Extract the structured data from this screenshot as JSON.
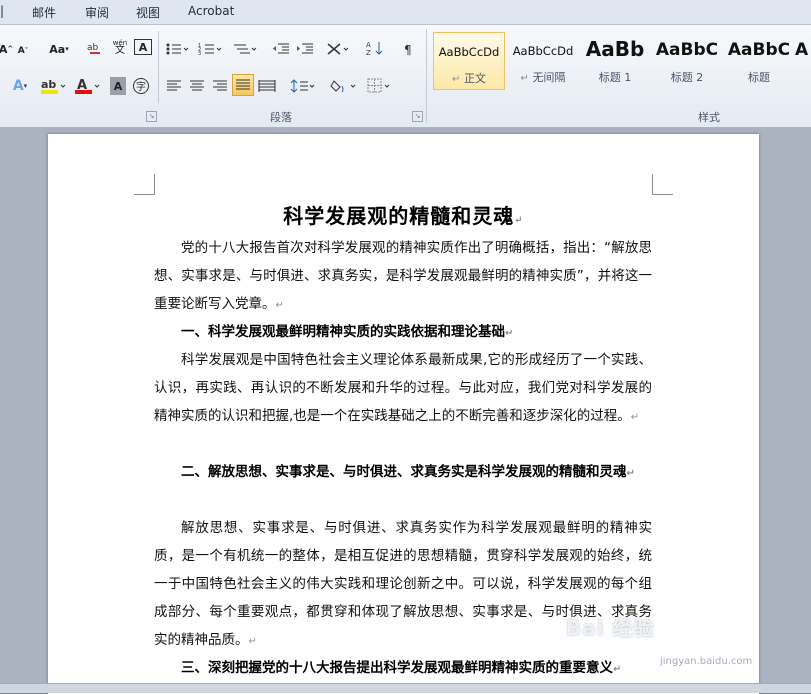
{
  "tabs": [
    "邮件",
    "审阅",
    "视图",
    "Acrobat"
  ],
  "ribbon": {
    "font_row1": {
      "grow": "A",
      "shrink": "A",
      "case": "Aa",
      "pinyin": "wén"
    },
    "para_label": "段落",
    "styles_label": "样式",
    "styles": [
      {
        "sample": "AaBbCcDd",
        "name": "正文"
      },
      {
        "sample": "AaBbCcDd",
        "name": "无间隔"
      },
      {
        "sample": "AaBb",
        "name": "标题 1"
      },
      {
        "sample": "AaBbC",
        "name": "标题 2"
      },
      {
        "sample": "AaBbC",
        "name": "标题"
      },
      {
        "sample": "A",
        "name": ""
      }
    ]
  },
  "document": {
    "title": "科学发展观的精髓和灵魂",
    "p1": "党的十八大报告首次对科学发展观的精神实质作出了明确概括，指出：“解放思想、实事求是、与时俱进、求真务实，是科学发展观最鲜明的精神实质”，并将这一重要论断写入党章。",
    "h1": "一、科学发展观最鲜明精神实质的实践依据和理论基础",
    "p2": "科学发展观是中国特色社会主义理论体系最新成果,它的形成经历了一个实践、认识，再实践、再认识的不断发展和升华的过程。与此对应，我们党对科学发展的精神实质的认识和把握,也是一个在实践基础之上的不断完善和逐步深化的过程。",
    "h2": "二、解放思想、实事求是、与时俱进、求真务实是科学发展观的精髓和灵魂",
    "p3": "解放思想、实事求是、与时俱进、求真务实作为科学发展观最鲜明的精神实质，是一个有机统一的整体，是相互促进的思想精髓，贯穿科学发展观的始终，统一于中国特色社会主义的伟大实践和理论创新之中。可以说，科学发展观的每个组成部分、每个重要观点，都贯穿和体现了解放思想、实事求是、与时俱进、求真务实的精神品质。",
    "h3": "三、深刻把握党的十八大报告提出科学发展观最鲜明精神实质的重要意义"
  },
  "watermark": {
    "text": "Bai 经验",
    "sub": "jingyan.baidu.com"
  },
  "colors": {
    "highlight": "#f5e300",
    "font_red": "#e01010",
    "selected_style": "#f1c15f"
  }
}
